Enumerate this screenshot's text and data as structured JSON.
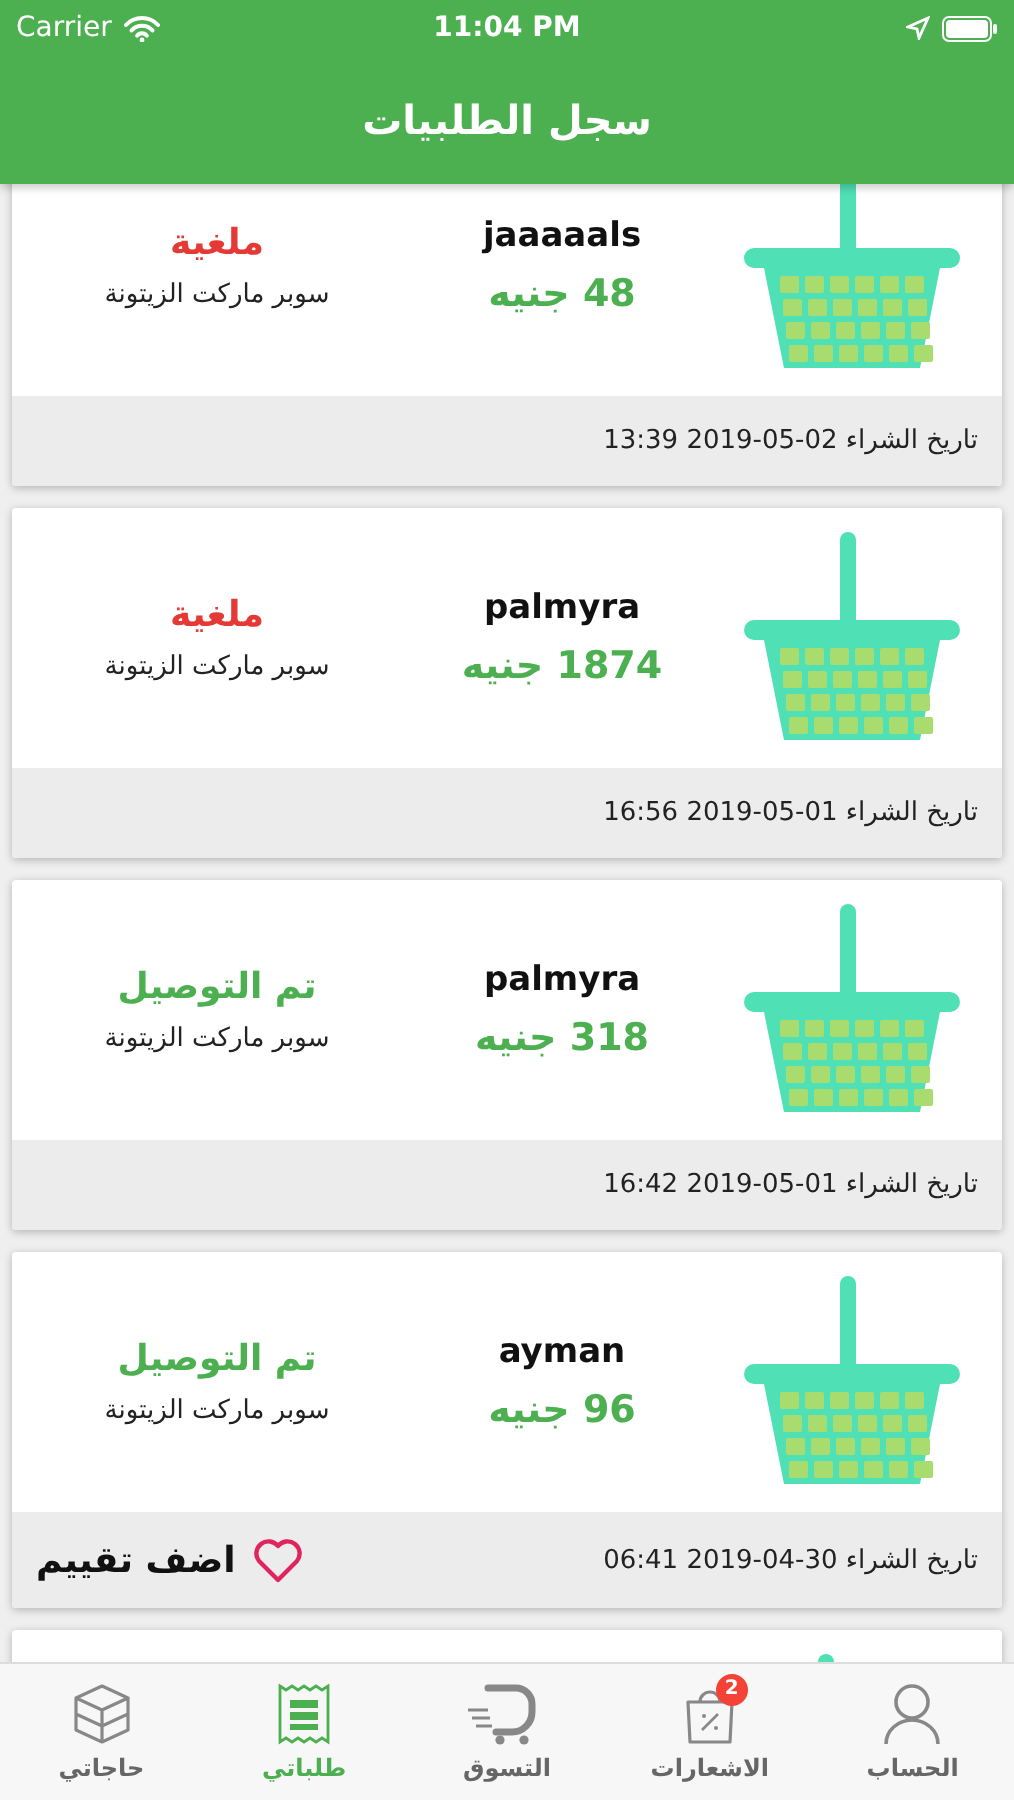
{
  "status_bar": {
    "carrier": "Carrier",
    "time": "11:04 PM"
  },
  "header": {
    "title": "سجل الطلبيات"
  },
  "orders": [
    {
      "customer": "jaaaaals",
      "price": "48 جنيه",
      "status": "ملغية",
      "kind": "cancelled",
      "store": "سوبر ماركت الزيتونة",
      "date": "تاريخ الشراء 02-05-2019 13:39"
    },
    {
      "customer": "palmyra",
      "price": "1874 جنيه",
      "status": "ملغية",
      "kind": "cancelled",
      "store": "سوبر ماركت الزيتونة",
      "date": "تاريخ الشراء 01-05-2019 16:56"
    },
    {
      "customer": "palmyra",
      "price": "318 جنيه",
      "status": "تم التوصيل",
      "kind": "delivered",
      "store": "سوبر ماركت الزيتونة",
      "date": "تاريخ الشراء 01-05-2019 16:42"
    },
    {
      "customer": "ayman",
      "price": "96 جنيه",
      "status": "تم التوصيل",
      "kind": "delivered",
      "store": "سوبر ماركت الزيتونة",
      "date": "تاريخ الشراء 30-04-2019 06:41",
      "rating_label": "اضف تقييم"
    }
  ],
  "tab_bar": [
    {
      "label": "الحساب",
      "selected": false
    },
    {
      "label": "الاشعارات",
      "selected": false,
      "badge": "2"
    },
    {
      "label": "التسوق",
      "selected": false
    },
    {
      "label": "طلباتي",
      "selected": true
    },
    {
      "label": "حاجاتي",
      "selected": false
    }
  ]
}
